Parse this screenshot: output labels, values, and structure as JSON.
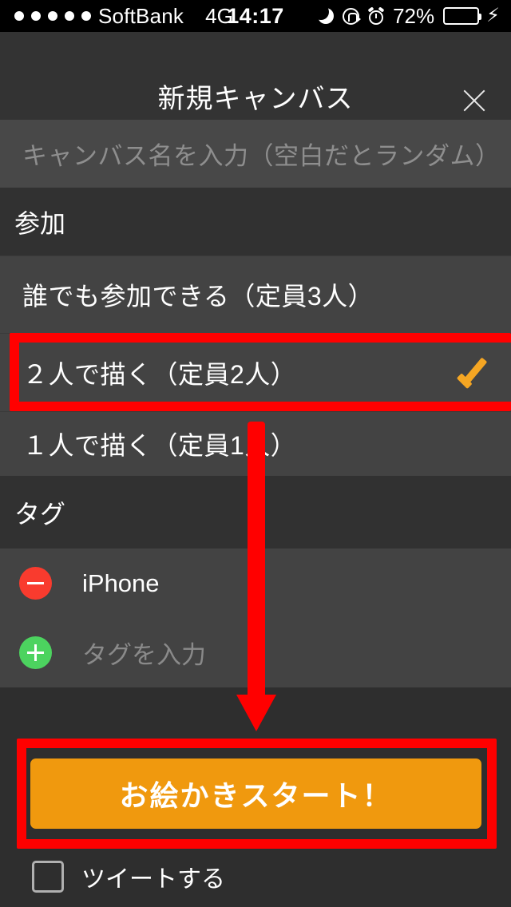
{
  "status_bar": {
    "signal_dots": 5,
    "carrier": "SoftBank",
    "network": "4G",
    "time": "14:17",
    "do_not_disturb_icon": "moon-icon",
    "orientation_lock_icon": "rotation-lock-icon",
    "alarm_icon": "alarm-clock-icon",
    "battery_percent": "72%",
    "battery_level": 72,
    "charging_icon": "lightning-bolt-icon",
    "battery_color": "#4CD964"
  },
  "navbar": {
    "title": "新規キャンバス",
    "close_icon": "close-icon"
  },
  "canvas_name": {
    "value": "",
    "placeholder": "キャンバス名を入力（空白だとランダム）"
  },
  "join_section": {
    "header": "参加",
    "options": [
      {
        "label": "誰でも参加できる（定員3人）",
        "selected": false
      },
      {
        "label": "２人で描く（定員2人）",
        "selected": true
      },
      {
        "label": "１人で描く（定員1人）",
        "selected": false
      }
    ],
    "check_icon": "checkmark-icon",
    "check_color": "#F5A623"
  },
  "tag_section": {
    "header": "タグ",
    "items": [
      {
        "icon": "minus-circle-icon",
        "icon_color": "#F93B2E",
        "label": "iPhone",
        "is_placeholder": false
      },
      {
        "icon": "plus-circle-icon",
        "icon_color": "#4CD35F",
        "label": "タグを入力",
        "is_placeholder": true
      }
    ]
  },
  "actions": {
    "start_label": "お絵かきスタート！",
    "start_color": "#F0990E",
    "tweet_label": "ツイートする",
    "tweet_checked": false
  },
  "annotations": {
    "highlight_color": "#FF0000",
    "highlighted_option": "２人で描く（定員2人）",
    "highlighted_button": "お絵かきスタート！",
    "arrow_icon": "down-arrow-icon"
  }
}
